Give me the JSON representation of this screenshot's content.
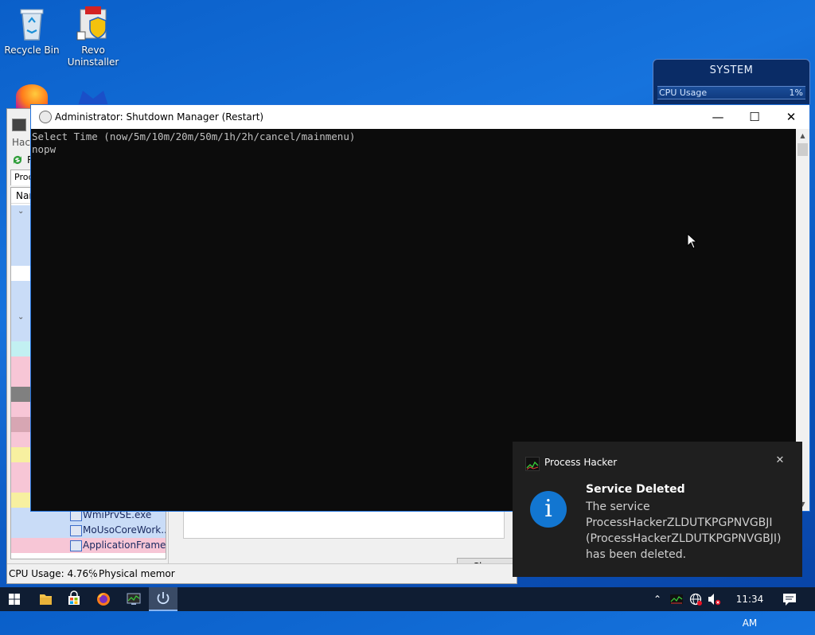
{
  "desktop": {
    "icons": [
      {
        "label": "Recycle Bin"
      },
      {
        "label": "Revo Uninstaller"
      }
    ]
  },
  "system_gadget": {
    "title": "SYSTEM",
    "cpu_label": "CPU Usage",
    "cpu_value": "1%"
  },
  "process_hacker": {
    "partial_labels": [
      "Hac",
      "R",
      "Proce",
      "Nar"
    ],
    "processes": [
      {
        "name": "WmiPrvSE.exe",
        "color": "#c9dcf7"
      },
      {
        "name": "MoUsoCoreWork...",
        "color": "#c9dcf7"
      },
      {
        "name": "ApplicationFrame...",
        "color": "#f7c6d6"
      }
    ],
    "status": {
      "cpu": "CPU Usage: 4.76%",
      "memory": "Physical memor"
    },
    "close_label": "Close"
  },
  "console": {
    "title": "Administrator:  Shutdown Manager (Restart)",
    "lines": [
      "Select Time (now/5m/10m/20m/50m/1h/2h/cancel/mainmenu)",
      "nopw"
    ]
  },
  "toast": {
    "app": "Process Hacker",
    "heading": "Service Deleted",
    "message": "The service ProcessHackerZLDUTKPGPNVGBJI (ProcessHackerZLDUTKPGPNVGBJI) has been deleted."
  },
  "taskbar": {
    "time": "11:34 AM"
  }
}
